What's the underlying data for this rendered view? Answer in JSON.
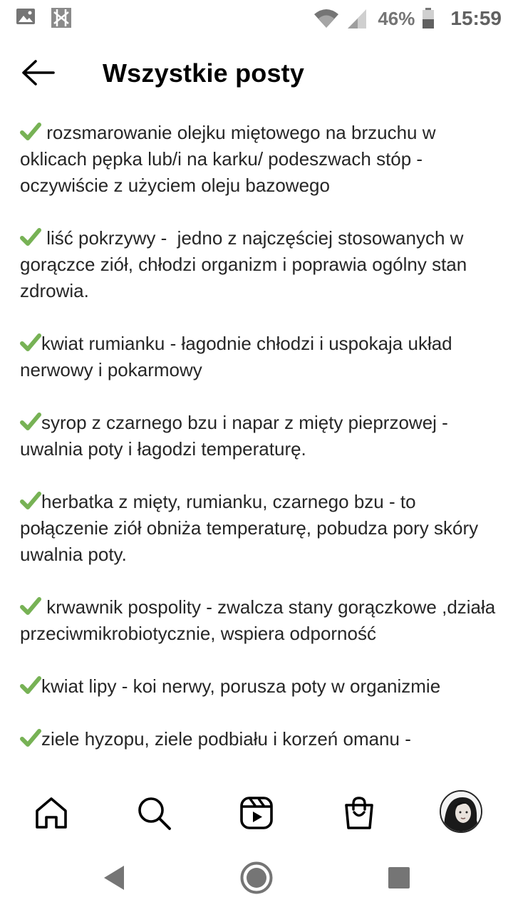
{
  "status_bar": {
    "battery_percent": "46%",
    "time": "15:59",
    "icons": [
      "image-notification-icon",
      "app-notification-icon",
      "wifi-icon",
      "signal-icon",
      "battery-icon"
    ]
  },
  "header": {
    "title": "Wszystkie posty",
    "back_icon": "arrow-left-icon"
  },
  "post": {
    "check_emoji": "check-mark-icon",
    "check_color": "#77b255",
    "paragraphs": [
      " rozsmarowanie olejku miętowego na brzuchu w oklicach pępka lub/i na karku/ podeszwach stóp - oczywiście z użyciem oleju bazowego",
      " liść pokrzywy -  jedno z najczęściej stosowanych w gorączce ziół, chłodzi organizm i poprawia ogólny stan zdrowia.",
      "kwiat rumianku - łagodnie chłodzi i uspokaja układ nerwowy i pokarmowy",
      "syrop z czarnego bzu i napar z mięty pieprzowej - uwalnia poty i łagodzi temperaturę.",
      "herbatka z mięty, rumianku, czarnego bzu - to połączenie ziół obniża temperaturę, pobudza pory skóry uwalnia poty.",
      " krwawnik pospolity - zwalcza stany gorączkowe ,działa przeciwmikrobiotycznie, wspiera odporność",
      "kwiat lipy - koi nerwy, porusza poty w organizmie",
      "ziele hyzopu, ziele podbiału i korzeń omanu -"
    ]
  },
  "bottom_nav": {
    "items": [
      "home-icon",
      "search-icon",
      "reels-icon",
      "shop-icon",
      "profile-avatar"
    ]
  },
  "system_nav": {
    "items": [
      "back-triangle-icon",
      "home-circle-icon",
      "recents-square-icon"
    ]
  }
}
